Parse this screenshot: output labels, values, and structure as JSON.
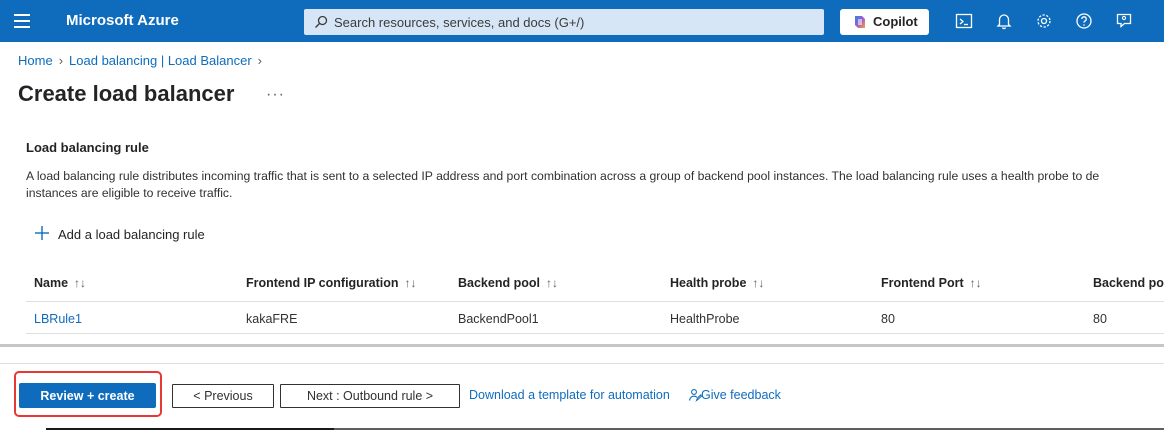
{
  "topbar": {
    "brand": "Microsoft Azure",
    "search_placeholder": "Search resources, services, and docs (G+/)",
    "copilot_label": "Copilot",
    "icons": [
      "cloud-shell-icon",
      "notifications-icon",
      "settings-icon",
      "help-icon",
      "feedback-icon"
    ]
  },
  "breadcrumb": {
    "items": [
      "Home",
      "Load balancing | Load Balancer"
    ]
  },
  "page": {
    "title": "Create load balancer",
    "more": "···"
  },
  "section": {
    "title": "Load balancing rule",
    "description_line1": "A load balancing rule distributes incoming traffic that is sent to a selected IP address and port combination across a group of backend pool instances. The load balancing rule uses a health probe to de",
    "description_line2": "instances are eligible to receive traffic.",
    "add_label": "Add a load balancing rule"
  },
  "table": {
    "columns": [
      "Name",
      "Frontend IP configuration",
      "Backend pool",
      "Health probe",
      "Frontend Port",
      "Backend por"
    ],
    "sort_glyph": "↑↓",
    "rows": [
      [
        "LBRule1",
        "kakaFRE",
        "BackendPool1",
        "HealthProbe",
        "80",
        "80"
      ]
    ]
  },
  "footer": {
    "review_label": "Review + create",
    "previous_label": "< Previous",
    "next_label": "Next : Outbound rule >",
    "download_label": "Download a template for automation",
    "feedback_label": "Give feedback"
  },
  "colors": {
    "accent": "#0f6cbd",
    "highlight": "#e53935"
  }
}
